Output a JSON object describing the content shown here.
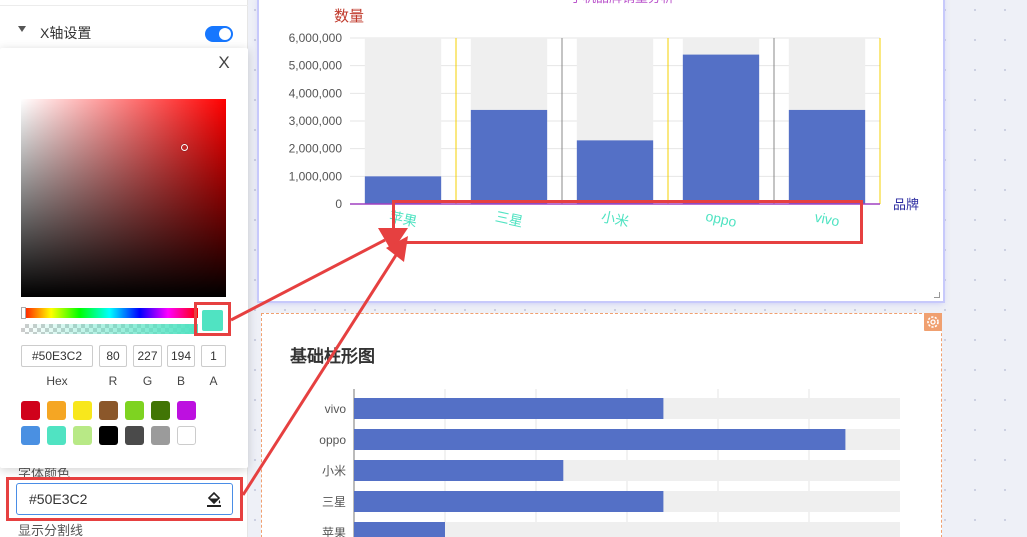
{
  "settings": {
    "xaxis_label": "X轴设置",
    "font_color_label": "字体颜色",
    "font_color_value": "#50E3C2",
    "split_line_label": "显示分割线"
  },
  "picker": {
    "close": "X",
    "hex": "#50E3C2",
    "r": "80",
    "g": "227",
    "b": "194",
    "a": "1",
    "labels": {
      "hex": "Hex",
      "r": "R",
      "g": "G",
      "b": "B",
      "a": "A"
    },
    "preset_colors": [
      "#D0021B",
      "#F5A623",
      "#F8E71C",
      "#8B572A",
      "#7ED321",
      "#417505",
      "#BD10E0",
      "#4A90E2",
      "#50E3C2",
      "#B8E986",
      "#000000",
      "#4A4A4A",
      "#9B9B9B",
      "#FFFFFF"
    ]
  },
  "card2": {
    "title": "基础柱形图"
  },
  "colors": {
    "accent": "#1677ff",
    "bar": "#5470c6",
    "label": "#50E3C2",
    "annotation": "#e64040"
  },
  "chart_data": [
    {
      "type": "bar",
      "title": "手机品牌销量分析",
      "ylabel": "数量",
      "xlabel": "品牌",
      "categories": [
        "苹果",
        "三星",
        "小米",
        "oppo",
        "vivo"
      ],
      "values": [
        1000000,
        3400000,
        2300000,
        5400000,
        3400000
      ],
      "ylim": [
        0,
        6000000
      ],
      "yticks": [
        "0",
        "1,000,000",
        "2,000,000",
        "3,000,000",
        "4,000,000",
        "5,000,000",
        "6,000,000"
      ],
      "background_bars": true
    },
    {
      "type": "bar",
      "orientation": "horizontal",
      "title": "基础柱形图",
      "categories": [
        "vivo",
        "oppo",
        "小米",
        "三星",
        "苹果"
      ],
      "values": [
        3400000,
        5400000,
        2300000,
        3400000,
        1000000
      ],
      "xlim": [
        0,
        6000000
      ],
      "background_bars": true
    }
  ]
}
